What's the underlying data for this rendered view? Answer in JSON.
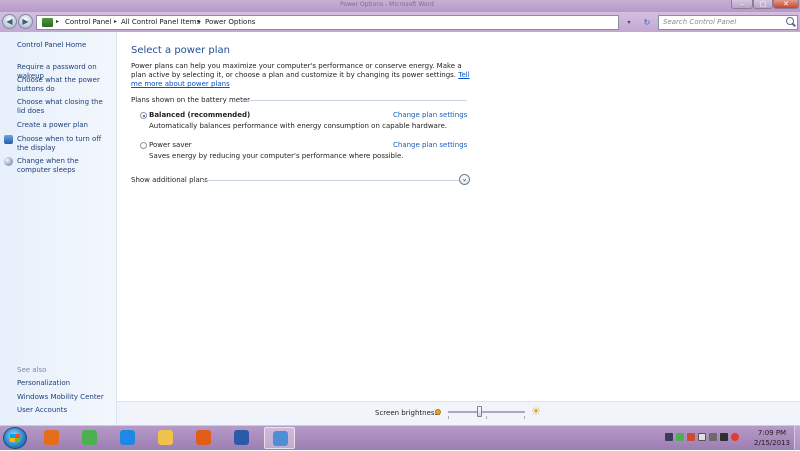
{
  "window": {
    "title": "Power Options - Microsoft Word",
    "minimize_glyph": "–",
    "maximize_glyph": "□",
    "close_glyph": "✕"
  },
  "nav": {
    "back_glyph": "◀",
    "forward_glyph": "▶",
    "breadcrumbs": [
      "Control Panel",
      "All Control Panel Items",
      "Power Options"
    ],
    "separator": "▸",
    "dropdown_glyph": "▾",
    "refresh_glyph": "↻",
    "search_placeholder": "Search Control Panel",
    "help_glyph": "?"
  },
  "sidebar": {
    "home": "Control Panel Home",
    "links": [
      {
        "label": "Require a password on wakeup"
      },
      {
        "label": "Choose what the power buttons do"
      },
      {
        "label": "Choose what closing the lid does"
      },
      {
        "label": "Create a power plan"
      },
      {
        "label": "Choose when to turn off the display",
        "icon": "monitor-icon"
      },
      {
        "label": "Change when the computer sleeps",
        "icon": "moon-icon"
      }
    ],
    "see_also_title": "See also",
    "see_also": [
      "Personalization",
      "Windows Mobility Center",
      "User Accounts"
    ]
  },
  "main": {
    "heading": "Select a power plan",
    "intro": "Power plans can help you maximize your computer's performance or conserve energy. Make a plan active by selecting it, or choose a plan and customize it by changing its power settings.",
    "intro_link": "Tell me more about power plans",
    "group_label": "Plans shown on the battery meter",
    "plans": [
      {
        "name": "Balanced (recommended)",
        "description": "Automatically balances performance with energy consumption on capable hardware.",
        "link": "Change plan settings",
        "selected": true
      },
      {
        "name": "Power saver",
        "description": "Saves energy by reducing your computer's performance where possible.",
        "link": "Change plan settings",
        "selected": false
      }
    ],
    "show_additional": "Show additional plans",
    "expand_glyph": "⌄"
  },
  "brightness": {
    "label": "Screen brightness:",
    "level_fraction": 0.4,
    "bright_icon": "☀"
  },
  "taskbar": {
    "apps": [
      {
        "name": "media-player-icon",
        "color": "#e56d1c"
      },
      {
        "name": "chrome-icon",
        "color": "#4caf50"
      },
      {
        "name": "internet-explorer-icon",
        "color": "#1e88e5"
      },
      {
        "name": "file-explorer-icon",
        "color": "#f0c24a"
      },
      {
        "name": "firefox-icon",
        "color": "#e25d1a"
      },
      {
        "name": "word-icon",
        "color": "#2a5ba8"
      },
      {
        "name": "control-panel-icon",
        "color": "#4d8ed6",
        "active": true
      }
    ],
    "time": "7:09 PM",
    "date": "2/15/2013"
  },
  "colors": {
    "title_bar": "#b79ac6",
    "link": "#1e3f7a",
    "heading": "#1f4e96",
    "sidebar_bg": "#e7f0fb"
  }
}
